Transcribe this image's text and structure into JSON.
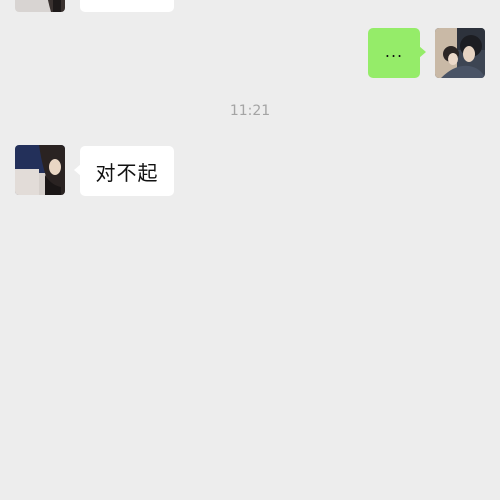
{
  "conversation": {
    "messages": [
      {
        "sender": "other",
        "text": ""
      },
      {
        "sender": "me",
        "text": "..."
      },
      {
        "sender": "other",
        "text": "对不起"
      }
    ],
    "timestamp": "11:21"
  },
  "colors": {
    "background": "#ededed",
    "incoming_bubble": "#ffffff",
    "outgoing_bubble": "#95ec69",
    "timestamp_text": "#a4a4a4"
  },
  "icons": {
    "other_avatar": "profile-photo-other",
    "my_avatar": "profile-photo-me"
  }
}
